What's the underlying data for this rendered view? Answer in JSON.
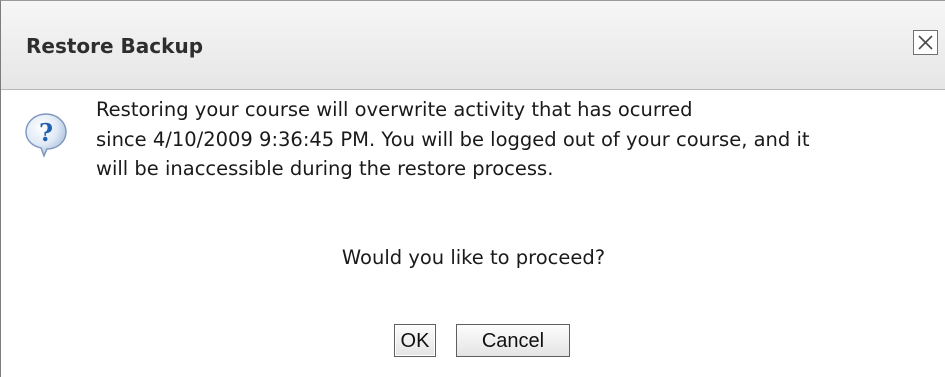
{
  "dialog": {
    "title": "Restore Backup",
    "close_icon": "close-icon",
    "icon": "question-icon",
    "message_lines": [
      "Restoring your course will overwrite activity that has ocurred",
      "since 4/10/2009 9:36:45 PM. You will be logged out of your course, and it",
      "will be inaccessible during the restore process."
    ],
    "prompt": "Would you like to proceed?",
    "buttons": {
      "ok_label": "OK",
      "cancel_label": "Cancel"
    }
  },
  "colors": {
    "titlebar": "#eeeeee",
    "title_text": "#2e2e2e",
    "icon_blue": "#1e5fb3",
    "border": "#7d7d7d"
  }
}
